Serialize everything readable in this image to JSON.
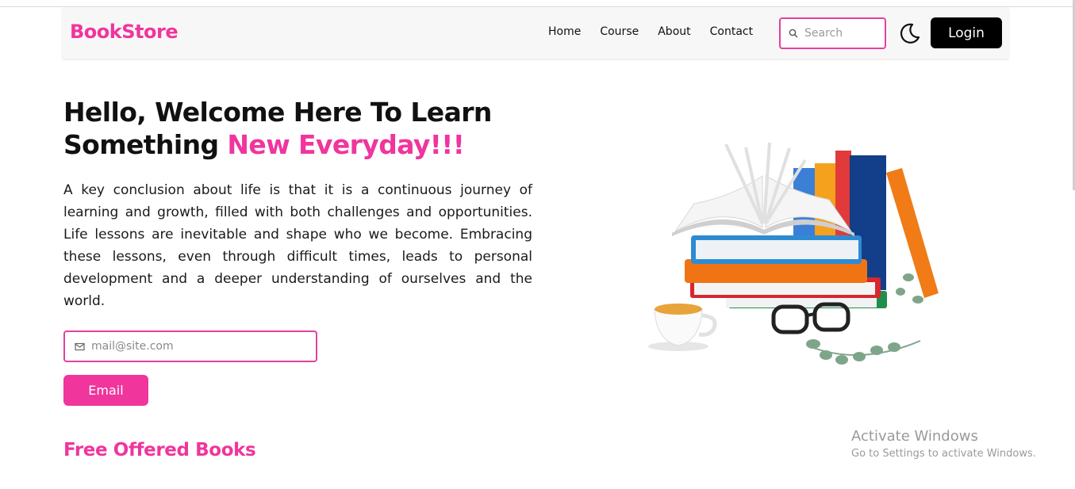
{
  "nav": {
    "brand": "BookStore",
    "links": [
      "Home",
      "Course",
      "About",
      "Contact"
    ],
    "search_placeholder": "Search",
    "login_label": "Login"
  },
  "hero": {
    "title_line1": "Hello, Welcome Here To Learn",
    "title_line2_plain": "Something",
    "title_line2_accent": "New Everyday!!!",
    "paragraph": "A key conclusion about life is that it is a continuous journey of learning and growth, filled with both challenges and opportunities. Life lessons are inevitable and shape who we become. Embracing these lessons, even through difficult times, leads to personal development and a deeper understanding of ourselves and the world.",
    "email_placeholder": "mail@site.com",
    "email_button": "Email"
  },
  "section": {
    "title": "Free Offered Books"
  },
  "watermark": {
    "title": "Activate Windows",
    "subtitle": "Go to Settings to activate Windows."
  },
  "icons": {
    "search": "search-icon",
    "theme_toggle": "moon-icon",
    "mail": "mail-icon"
  },
  "colors": {
    "accent": "#f0359d",
    "login_bg": "#000000",
    "navbar_bg": "#f7f7f7"
  }
}
